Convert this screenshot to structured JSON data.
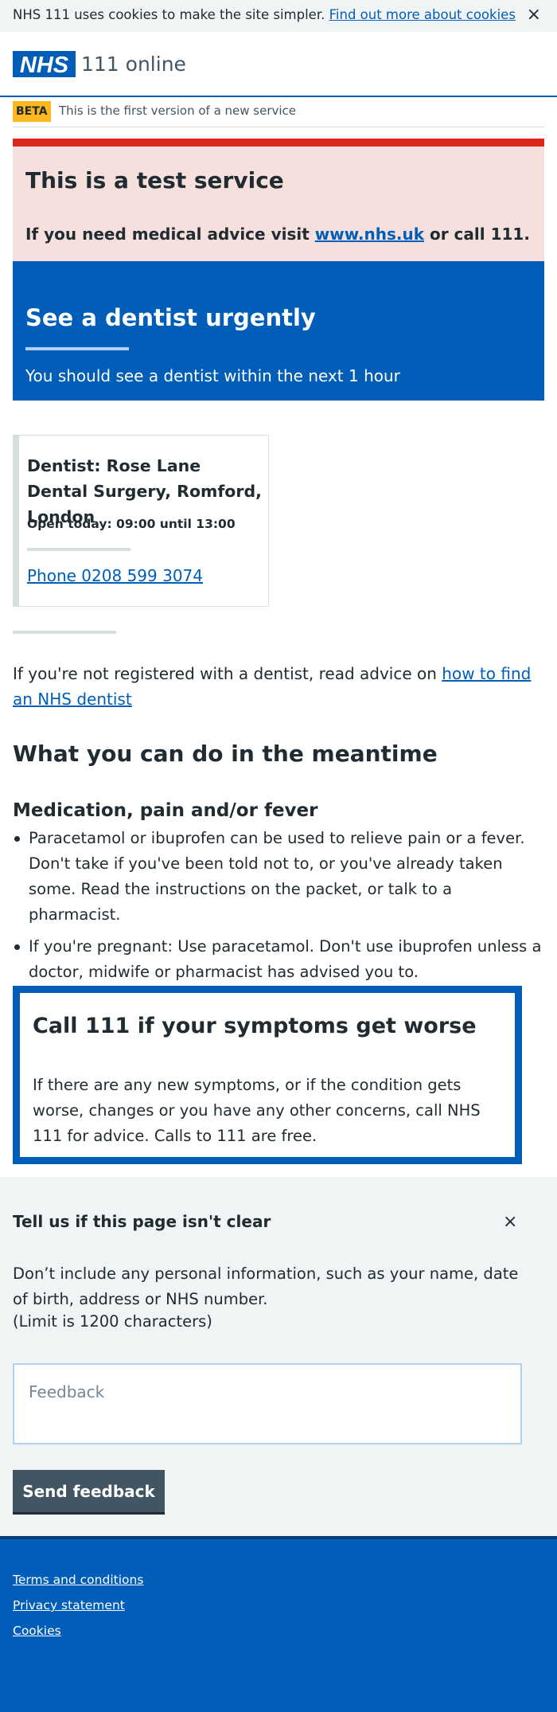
{
  "cookie_banner": {
    "text": "NHS 111 uses cookies to make the site simpler.",
    "link_label": "Find out more about cookies",
    "close_symbol": "×"
  },
  "header": {
    "logo_text": "NHS",
    "service_name": "111 online"
  },
  "beta": {
    "tag": "BETA",
    "text": "This is the first version of a new service"
  },
  "test_banner": {
    "title": "This is a test service",
    "body_prefix": "If you need medical advice visit",
    "link_label": "www.nhs.uk",
    "body_suffix": "or call 111."
  },
  "result": {
    "title": "See a dentist urgently",
    "subtitle": "You should see a dentist within the next 1 hour"
  },
  "dentist": {
    "name": "Dentist: Rose Lane Dental Surgery, Romford, London",
    "hours": "Open today: 09:00 until 13:00",
    "phone_label": "Phone 0208 599 3074"
  },
  "registration": {
    "text": "If you're not registered with a dentist, read advice on",
    "link_label": "how to find an NHS dentist"
  },
  "meantime": {
    "heading": "What you can do in the meantime",
    "subheading": "Medication, pain and/or fever",
    "items": [
      "Paracetamol or ibuprofen can be used to relieve pain or a fever. Don't take if you've been told not to, or you've already taken some. Read the instructions on the packet, or talk to a pharmacist.",
      "If you're pregnant: Use paracetamol. Don't use ibuprofen unless a doctor, midwife or pharmacist has advised you to."
    ]
  },
  "worsen": {
    "title": "Call 111 if your symptoms get worse",
    "body": "If there are any new symptoms, or if the condition gets worse, changes or you have any other concerns, call NHS 111 for advice. Calls to 111 are free."
  },
  "feedback": {
    "title": "Tell us if this page isn't clear",
    "close_symbol": "×",
    "description": "Don’t include any personal information, such as your name, date of birth, address or NHS number.",
    "limit": "(Limit is 1200 characters)",
    "placeholder": "Feedback",
    "value": "",
    "button_label": "Send feedback"
  },
  "footer": {
    "links": [
      "Terms and conditions",
      "Privacy statement",
      "Cookies"
    ]
  },
  "colors": {
    "nhs_blue": "#005eb8",
    "alert_red": "#da291c",
    "beta_yellow": "#ffb81c",
    "pale_grey": "#f0f4f5",
    "button_grey": "#425563"
  },
  "icons": {
    "cookie_close": "close-icon",
    "feedback_close": "close-icon",
    "logo": "nhs-logo"
  }
}
